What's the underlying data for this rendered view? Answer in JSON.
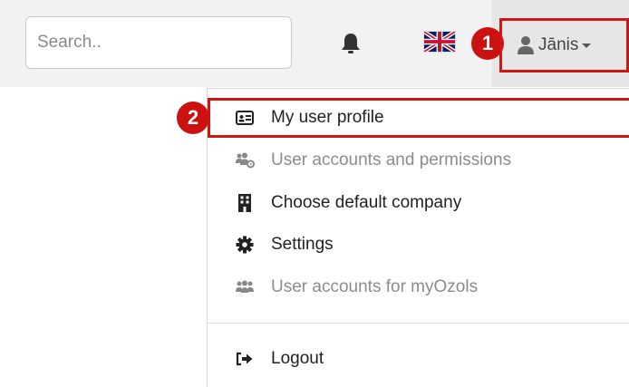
{
  "search": {
    "placeholder": "Search.."
  },
  "header": {
    "notifications_icon": "bell-icon",
    "language_icon": "uk-flag-icon",
    "user_icon": "user-icon",
    "user_name": "Jānis"
  },
  "annotations": {
    "marker_1": "1",
    "marker_2": "2",
    "marker_color": "#cc1111"
  },
  "menu": {
    "items": [
      {
        "label": "My user profile",
        "icon": "id-card-icon",
        "enabled": true
      },
      {
        "label": "User accounts and permissions",
        "icon": "users-cog-icon",
        "enabled": false
      },
      {
        "label": "Choose default company",
        "icon": "building-icon",
        "enabled": true
      },
      {
        "label": "Settings",
        "icon": "gear-icon",
        "enabled": true
      },
      {
        "label": "User accounts for myOzols",
        "icon": "users-icon",
        "enabled": false
      },
      {
        "label": "Logout",
        "icon": "sign-out-icon",
        "enabled": true
      }
    ]
  },
  "colors": {
    "highlight": "#d01515",
    "topbar_bg": "#f2f2f2",
    "user_area_bg": "#e6e6e6",
    "disabled_text": "#8c8c8c"
  }
}
